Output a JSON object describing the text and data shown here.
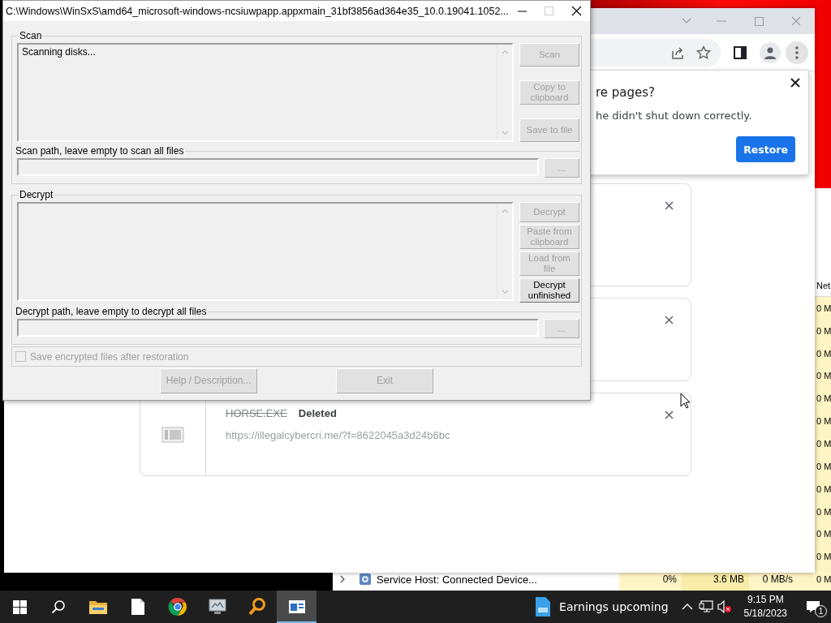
{
  "dialog": {
    "title": "C:\\Windows\\WinSxS\\amd64_microsoft-windows-ncsiuwpapp.appxmain_31bf3856ad364e35_10.0.19041.1052...",
    "maximize_disabled": true,
    "groups": [
      {
        "label": "Scan",
        "log": "Scanning disks...",
        "buttons": [
          {
            "label": "Scan",
            "disabled": true
          },
          {
            "label": "Copy to clipboard",
            "disabled": true
          },
          {
            "label": "Save to file",
            "disabled": true
          }
        ],
        "path_label": "Scan path, leave empty to scan all files",
        "browse": {
          "label": "...",
          "disabled": true
        }
      },
      {
        "label": "Decrypt",
        "buttons": [
          {
            "label": "Decrypt",
            "disabled": true
          },
          {
            "label": "Paste from clipboard",
            "disabled": true
          },
          {
            "label": "Load from file",
            "disabled": true
          },
          {
            "label": "Decrypt unfinished",
            "disabled": false
          }
        ],
        "path_label": "Decrypt path, leave empty to decrypt all files",
        "browse": {
          "label": "...",
          "disabled": true
        }
      }
    ],
    "save_encrypted": {
      "label": "Save encrypted files after restoration",
      "checked": false,
      "disabled": true
    },
    "footer_buttons": [
      {
        "label": "Help / Description...",
        "disabled": true
      },
      {
        "label": "Exit",
        "disabled": true
      }
    ]
  },
  "browser": {
    "restore_popup": {
      "title": "re pages?",
      "message": "he didn't shut down correctly.",
      "button": "Restore"
    },
    "downloads": [
      {
        "kind": "covered"
      },
      {
        "kind": "covered"
      },
      {
        "kind": "file",
        "filename": "HORSE.EXE",
        "status": "Deleted",
        "url": "https://illegalcybercri.me/?f=8622045a3d24b6bc"
      }
    ]
  },
  "task_manager": {
    "net_header": "Net",
    "rows": [
      {
        "net": "0 M"
      },
      {
        "net": "0 M"
      },
      {
        "net": "0 M"
      },
      {
        "net": "0 M"
      },
      {
        "net": "0 M"
      },
      {
        "net": "0 M"
      },
      {
        "net": "0 M"
      },
      {
        "net": "0 M"
      },
      {
        "net": "0 M"
      },
      {
        "net": "0 M"
      },
      {
        "net": "0 M"
      },
      {
        "net": "0 M"
      },
      {
        "name": "Service Host: Connected Device...",
        "cpu": "0%",
        "memory": "3.6 MB",
        "disk": "0 MB/s",
        "net": "0 M"
      }
    ]
  },
  "taskbar": {
    "apps": [
      {
        "kind": "folder",
        "selected": false
      },
      {
        "kind": "file",
        "selected": false
      },
      {
        "kind": "browser",
        "selected": false
      },
      {
        "kind": "monitor",
        "selected": false
      },
      {
        "kind": "magnifier",
        "selected": false
      },
      {
        "kind": "window",
        "selected": true
      }
    ],
    "news": "Earnings upcoming",
    "time": "9:15 PM",
    "date": "5/18/2023",
    "notification_count": "1"
  }
}
